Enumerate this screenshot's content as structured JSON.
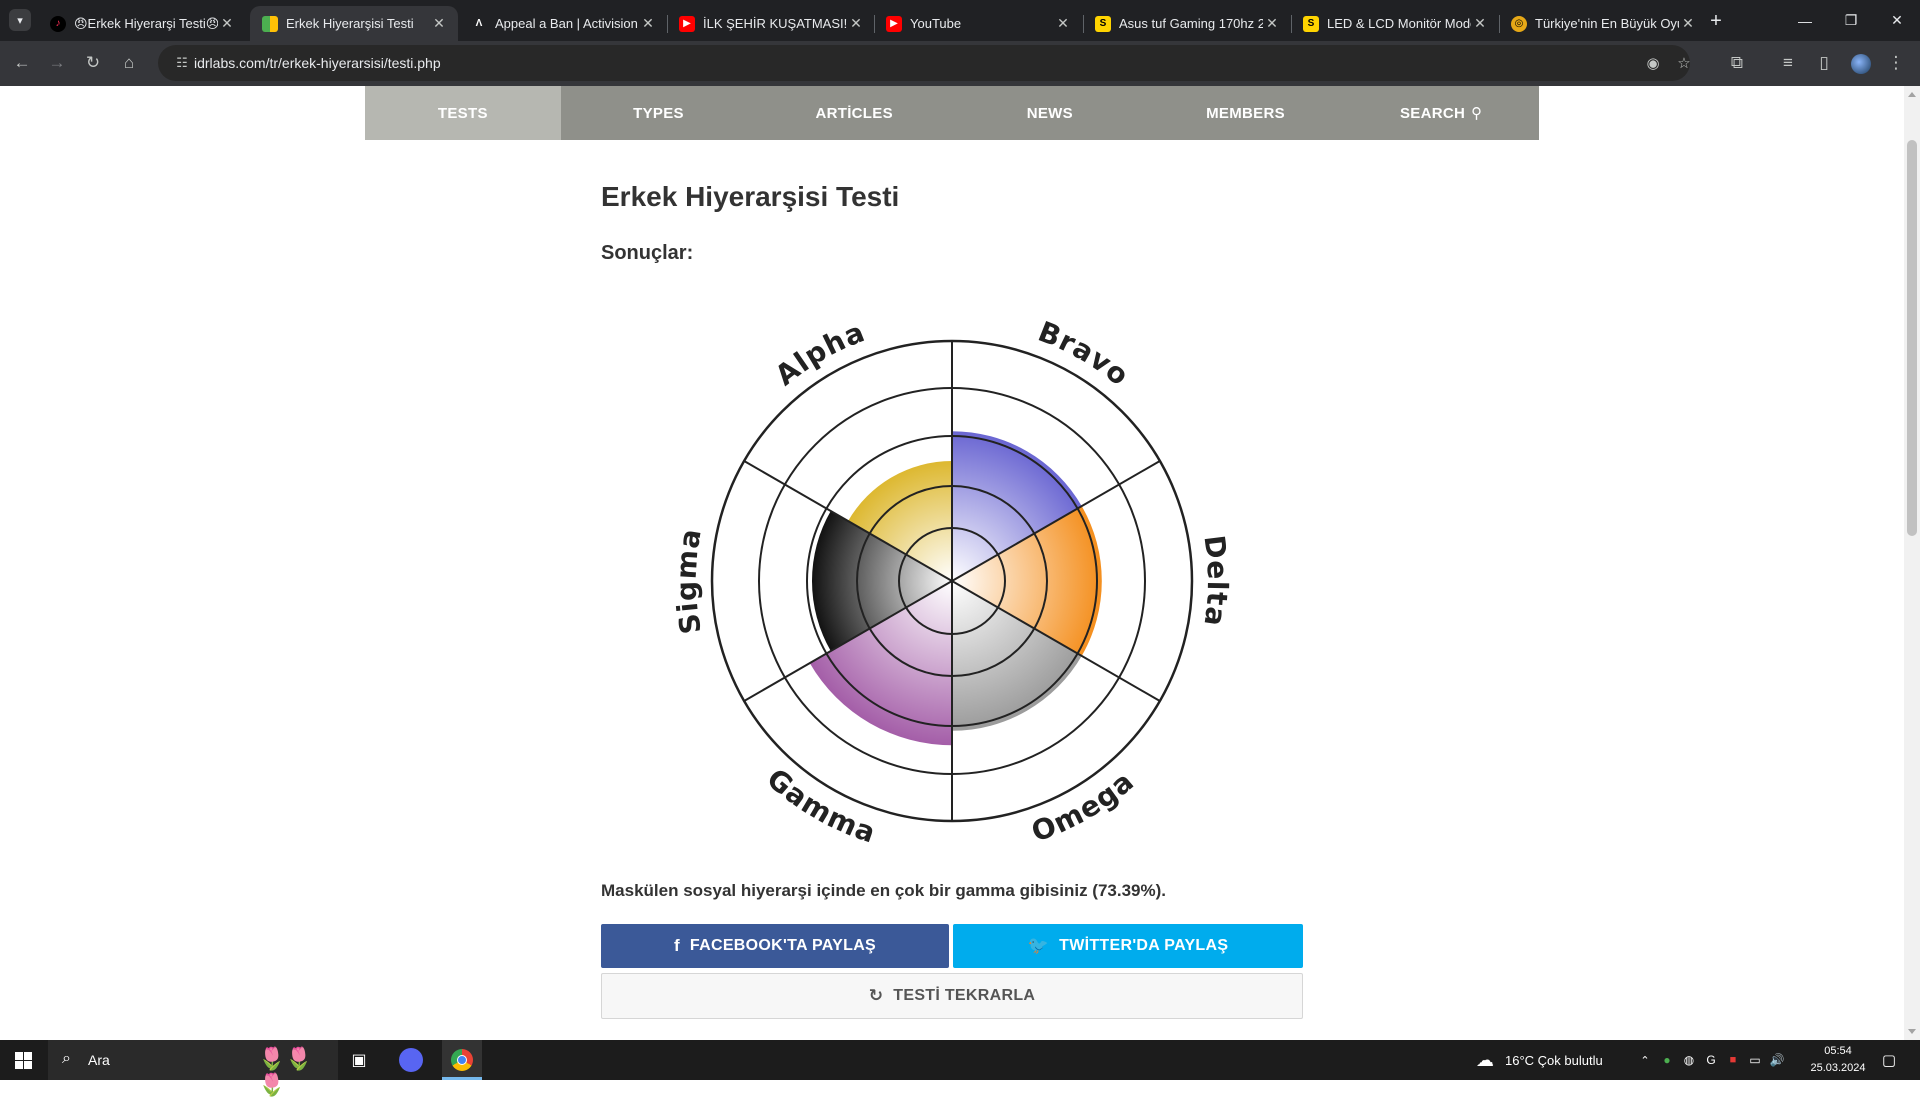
{
  "browser": {
    "tabs": [
      {
        "title": "😠Erkek Hiyerarşi Testi😠",
        "icon": "tiktok-icon",
        "active": false
      },
      {
        "title": "Erkek Hiyerarşisi Testi",
        "icon": "idrlabs-icon",
        "active": true
      },
      {
        "title": "Appeal a Ban | Activision S",
        "icon": "activision-icon",
        "active": false
      },
      {
        "title": "İLK ŞEHİR KUŞATMASI! | M",
        "icon": "youtube-icon",
        "active": false
      },
      {
        "title": "YouTube",
        "icon": "youtube-icon",
        "active": false
      },
      {
        "title": "Asus tuf Gaming 170hz 2",
        "icon": "s-icon",
        "active": false
      },
      {
        "title": "LED & LCD Monitör Mode",
        "icon": "s-icon",
        "active": false
      },
      {
        "title": "Türkiye'nin En Büyük Oyu",
        "icon": "site-icon",
        "active": false
      }
    ],
    "url": "idrlabs.com/tr/erkek-hiyerarsisi/testi.php"
  },
  "site_nav": {
    "items": [
      "TESTS",
      "TYPES",
      "ARTİCLES",
      "NEWS",
      "MEMBERS",
      "SEARCH"
    ],
    "active": "TESTS"
  },
  "page": {
    "title": "Erkek Hiyerarşisi Testi",
    "results_label": "Sonuçlar:",
    "result_text": "Maskülen sosyal hiyerarşi içinde en çok bir gamma gibisiniz (73.39%).",
    "share_facebook": "FACEBOOK'TA PAYLAŞ",
    "share_twitter": "TWİTTER'DA PAYLAŞ",
    "retry": "TESTİ TEKRARLA"
  },
  "chart_data": {
    "type": "radial-bar",
    "scale_max": 4,
    "categories": [
      "Alpha",
      "Bravo",
      "Delta",
      "Omega",
      "Gamma",
      "Sigma"
    ],
    "values": [
      2.5,
      3.1,
      3.1,
      3.1,
      3.4,
      2.9
    ],
    "colors": [
      "#ddb830",
      "#6a66d2",
      "#f48f1e",
      "#9b9b9b",
      "#a45ea8",
      "#121212"
    ]
  },
  "taskbar": {
    "search_placeholder": "Ara",
    "weather": "16°C  Çok bulutlu",
    "time": "05:54",
    "date": "25.03.2024"
  }
}
